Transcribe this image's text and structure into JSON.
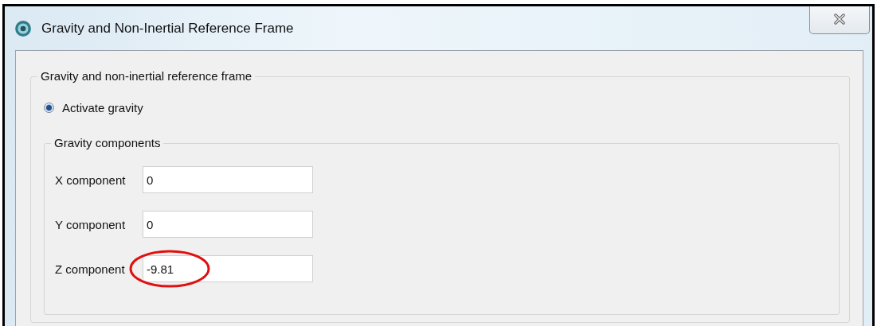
{
  "window": {
    "title": "Gravity and Non-Inertial Reference Frame"
  },
  "group": {
    "title": "Gravity and non-inertial reference frame",
    "radio": {
      "label": "Activate gravity",
      "selected": true
    },
    "components": {
      "title": "Gravity components",
      "fields": [
        {
          "label": "X component",
          "value": "0",
          "highlighted": false
        },
        {
          "label": "Y component",
          "value": "0",
          "highlighted": false
        },
        {
          "label": "Z component",
          "value": "-9.81",
          "highlighted": true
        }
      ]
    }
  }
}
